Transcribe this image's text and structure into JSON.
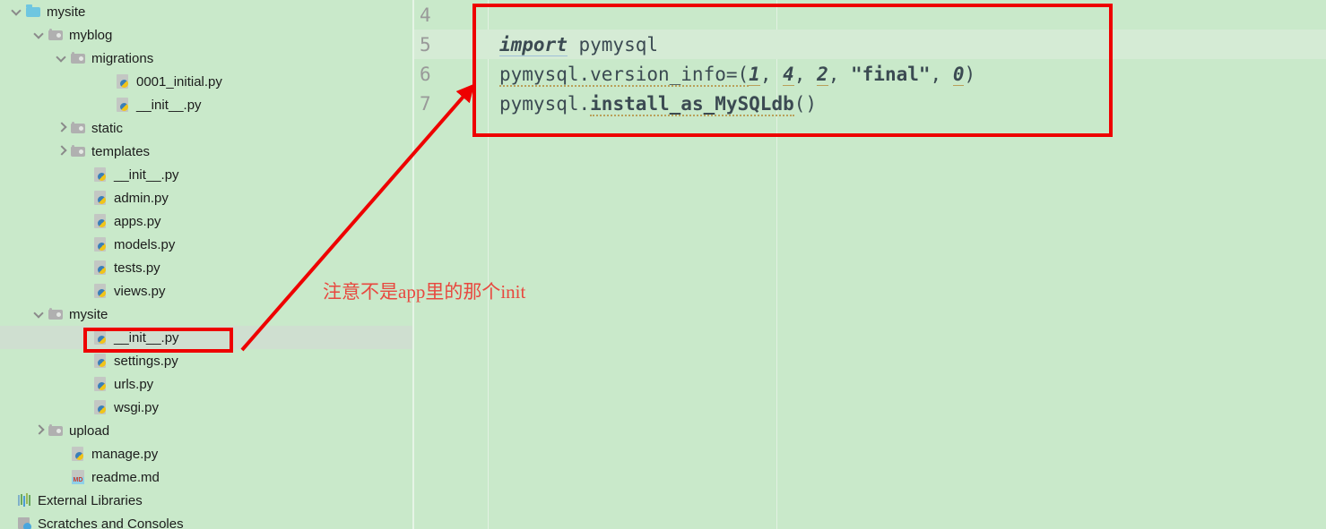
{
  "theme": {
    "background": "#c9e9ca",
    "selected_row": "#cfdfd0",
    "current_line": "#d5ebd5",
    "annotation_red": "#ee0000",
    "annotation_text_color": "#e8483f",
    "code_text": "#3b4a52",
    "gutter_text": "#999999"
  },
  "project_tree": {
    "name": "project-tree",
    "items": [
      {
        "label": "mysite",
        "indent": 0,
        "twisty": "down",
        "icon": "folder-blue-icon",
        "selected": false
      },
      {
        "label": "myblog",
        "indent": 1,
        "twisty": "down",
        "icon": "folder-gray-icon",
        "selected": false
      },
      {
        "label": "migrations",
        "indent": 2,
        "twisty": "down",
        "icon": "folder-gray-icon",
        "selected": false
      },
      {
        "label": "0001_initial.py",
        "indent": 4,
        "twisty": "none",
        "icon": "python-file-icon",
        "selected": false
      },
      {
        "label": "__init__.py",
        "indent": 4,
        "twisty": "none",
        "icon": "python-file-icon",
        "selected": false
      },
      {
        "label": "static",
        "indent": 2,
        "twisty": "right",
        "icon": "folder-gray-icon",
        "selected": false
      },
      {
        "label": "templates",
        "indent": 2,
        "twisty": "right",
        "icon": "folder-gray-icon",
        "selected": false
      },
      {
        "label": "__init__.py",
        "indent": 3,
        "twisty": "none",
        "icon": "python-file-icon",
        "selected": false
      },
      {
        "label": "admin.py",
        "indent": 3,
        "twisty": "none",
        "icon": "python-file-icon",
        "selected": false
      },
      {
        "label": "apps.py",
        "indent": 3,
        "twisty": "none",
        "icon": "python-file-icon",
        "selected": false
      },
      {
        "label": "models.py",
        "indent": 3,
        "twisty": "none",
        "icon": "python-file-icon",
        "selected": false
      },
      {
        "label": "tests.py",
        "indent": 3,
        "twisty": "none",
        "icon": "python-file-icon",
        "selected": false
      },
      {
        "label": "views.py",
        "indent": 3,
        "twisty": "none",
        "icon": "python-file-icon",
        "selected": false
      },
      {
        "label": "mysite",
        "indent": 1,
        "twisty": "down",
        "icon": "folder-gray-icon",
        "selected": false
      },
      {
        "label": "__init__.py",
        "indent": 3,
        "twisty": "none",
        "icon": "python-file-icon",
        "selected": true
      },
      {
        "label": "settings.py",
        "indent": 3,
        "twisty": "none",
        "icon": "python-file-icon",
        "selected": false
      },
      {
        "label": "urls.py",
        "indent": 3,
        "twisty": "none",
        "icon": "python-file-icon",
        "selected": false
      },
      {
        "label": "wsgi.py",
        "indent": 3,
        "twisty": "none",
        "icon": "python-file-icon",
        "selected": false
      },
      {
        "label": "upload",
        "indent": 1,
        "twisty": "right",
        "icon": "folder-gray-icon",
        "selected": false
      },
      {
        "label": "manage.py",
        "indent": 2,
        "twisty": "none",
        "icon": "python-file-icon",
        "selected": false
      },
      {
        "label": "readme.md",
        "indent": 2,
        "twisty": "none",
        "icon": "markdown-file-icon",
        "selected": false
      },
      {
        "label": "External Libraries",
        "indent": -1,
        "twisty": "none",
        "icon": "external-libraries-icon",
        "selected": false
      },
      {
        "label": "Scratches and Consoles",
        "indent": -1,
        "twisty": "none",
        "icon": "scratches-icon",
        "selected": false
      }
    ]
  },
  "editor": {
    "name": "code-editor",
    "first_visible_line": 4,
    "current_line": 5,
    "lines": [
      {
        "number": "4",
        "text": "",
        "current": false
      },
      {
        "number": "5",
        "text": "import pymysql",
        "current": true
      },
      {
        "number": "6",
        "text": "pymysql.version_info=(1, 4, 2, \"final\", 0)",
        "current": false
      },
      {
        "number": "7",
        "text": "pymysql.install_as_MySQLdb()",
        "current": false
      }
    ],
    "tokens": {
      "line5": {
        "keyword": "import",
        "rest": " pymysql"
      },
      "line6": {
        "prefix": "pymysql.version_info=(",
        "n1": "1",
        "sep1": ", ",
        "n2": "4",
        "sep2": ", ",
        "n3": "2",
        "sep3": ", ",
        "string": "\"final\"",
        "sep4": ", ",
        "n4": "0",
        "suffix": ")"
      },
      "line7": {
        "prefix": "pymysql.",
        "call": "install_as_MySQLdb",
        "suffix": "()"
      }
    }
  },
  "annotations": {
    "note_text": "注意不是app里的那个init",
    "code_box_label": "code-highlight-box",
    "file_box_label": "file-highlight-box",
    "arrow_label": "pointer-arrow"
  }
}
